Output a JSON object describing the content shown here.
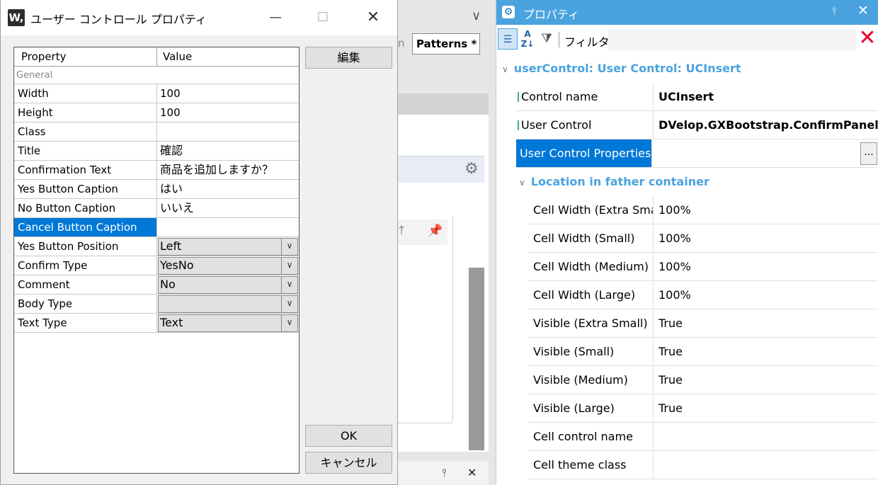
{
  "background_ide": {
    "tab_fragment": "n",
    "patterns_tab_label": "Patterns *"
  },
  "dialog": {
    "app_icon_text": "W,",
    "title": "ユーザー コントロール プロパティ",
    "grid": {
      "header_property": "Property",
      "header_value": "Value",
      "category": "General",
      "rows": [
        {
          "name": "Width",
          "value": "100"
        },
        {
          "name": "Height",
          "value": "100"
        },
        {
          "name": "Class",
          "value": ""
        },
        {
          "name": "Title",
          "value": "確認"
        },
        {
          "name": "Confirmation Text",
          "value": "商品を追加しますか？"
        },
        {
          "name": "Yes Button Caption",
          "value": "はい"
        },
        {
          "name": "No Button Caption",
          "value": "いいえ"
        },
        {
          "name": "Cancel Button Caption",
          "value": ""
        },
        {
          "name": "Yes Button Position",
          "value": "Left"
        },
        {
          "name": "Confirm Type",
          "value": "YesNo"
        },
        {
          "name": "Comment",
          "value": "No"
        },
        {
          "name": "Body Type",
          "value": ""
        },
        {
          "name": "Text Type",
          "value": "Text"
        }
      ]
    },
    "edit_button": "編集",
    "ok_button": "OK",
    "cancel_button": "キャンセル"
  },
  "properties_panel": {
    "title": "プロパティ",
    "filter_label": "フィルタ",
    "filter_value": "",
    "group_usercontrol": "userControl: User Control: UCInsert",
    "rows": [
      {
        "name": "Control name",
        "value": "UCInsert"
      },
      {
        "name": "User Control",
        "value": "DVelop.GXBootstrap.ConfirmPanel"
      },
      {
        "name": "User Control Properties",
        "value": "",
        "ellipsis": "..."
      }
    ],
    "group_location": "Location in father container",
    "location_rows": [
      {
        "name": "Cell Width (Extra Small)",
        "value": "100%"
      },
      {
        "name": "Cell Width (Small)",
        "value": "100%"
      },
      {
        "name": "Cell Width (Medium)",
        "value": "100%"
      },
      {
        "name": "Cell Width (Large)",
        "value": "100%"
      },
      {
        "name": "Visible (Extra Small)",
        "value": "True"
      },
      {
        "name": "Visible (Small)",
        "value": "True"
      },
      {
        "name": "Visible (Medium)",
        "value": "True"
      },
      {
        "name": "Visible (Large)",
        "value": "True"
      },
      {
        "name": "Cell control name",
        "value": ""
      },
      {
        "name": "Cell theme class",
        "value": ""
      }
    ]
  },
  "colors": {
    "accent": "#4aa3df",
    "selection": "#0078d7"
  }
}
